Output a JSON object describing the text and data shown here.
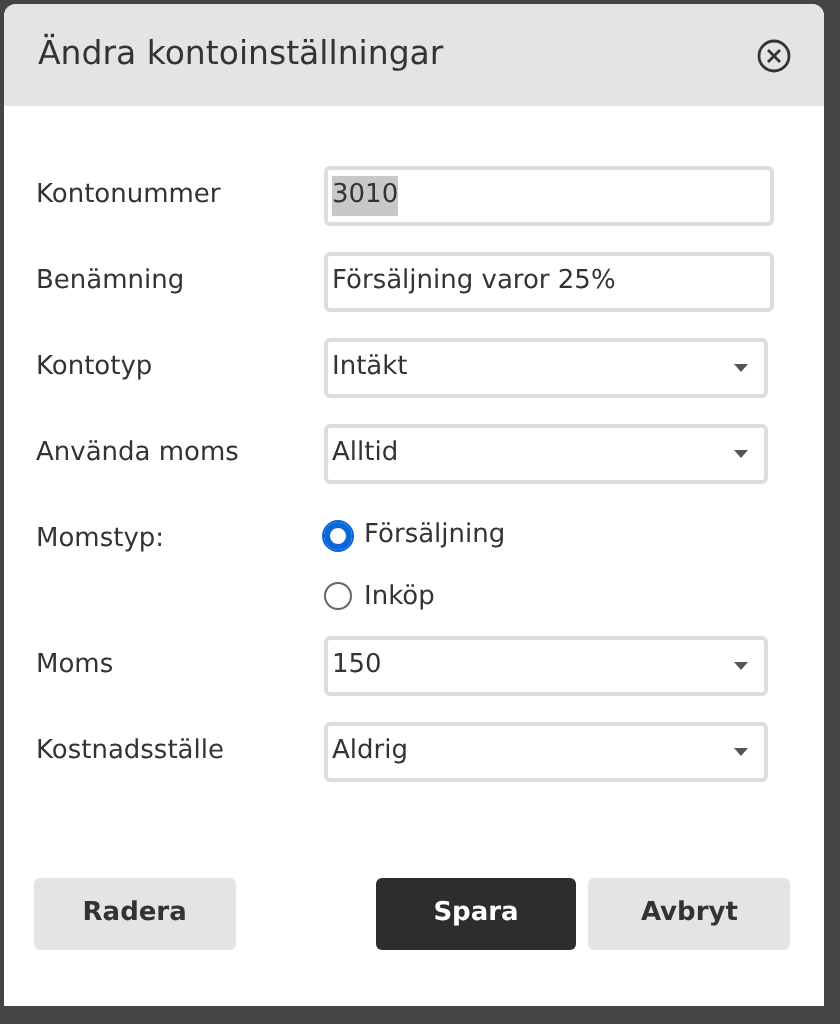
{
  "dialog": {
    "title": "Ändra kontoinställningar",
    "fields": [
      {
        "kind": "text",
        "label": "Kontonummer",
        "value": "3010",
        "highlighted": true
      },
      {
        "kind": "text",
        "label": "Benämning",
        "value": "Försäljning varor 25%",
        "highlighted": false
      },
      {
        "kind": "select",
        "label": "Kontotyp",
        "value": "Intäkt"
      },
      {
        "kind": "select",
        "label": "Använda moms",
        "value": "Alltid"
      },
      {
        "kind": "radio",
        "label": "Momstyp:",
        "options": [
          {
            "label": "Försäljning",
            "selected": true
          },
          {
            "label": "Inköp",
            "selected": false
          }
        ]
      },
      {
        "kind": "select",
        "label": "Moms",
        "value": "150"
      },
      {
        "kind": "select",
        "label": "Kostnadsställe",
        "value": "Aldrig"
      }
    ],
    "buttons": [
      {
        "kind": "secondary",
        "label": "Radera"
      },
      {
        "kind": "primary",
        "label": "Spara"
      },
      {
        "kind": "secondary",
        "label": "Avbryt"
      }
    ]
  }
}
